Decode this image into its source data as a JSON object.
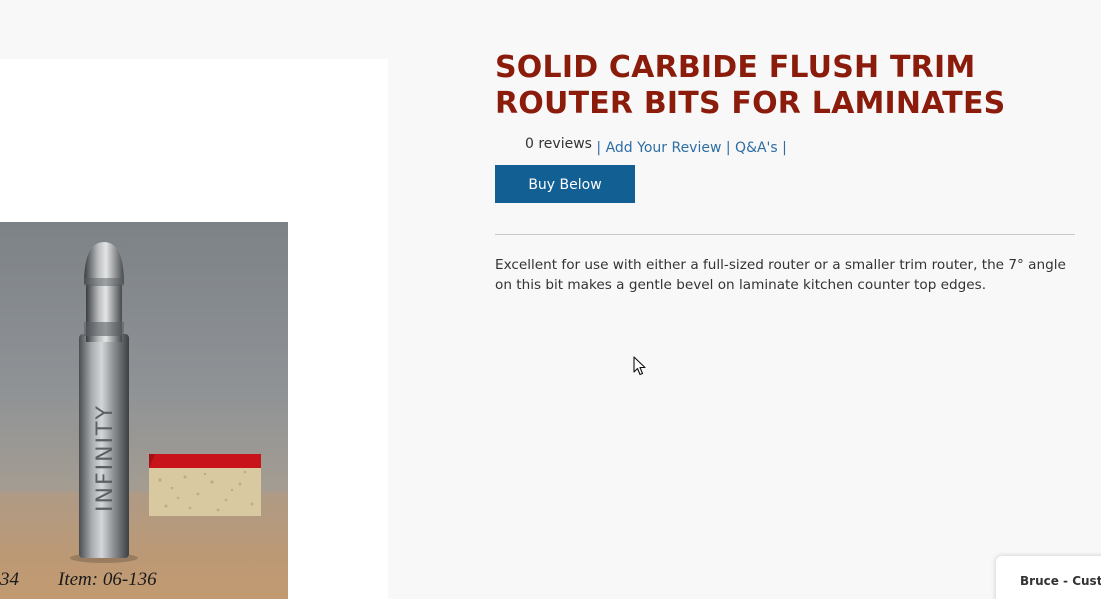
{
  "product": {
    "title": "SOLID CARBIDE FLUSH TRIM ROUTER BITS FOR LAMINATES",
    "reviews_count": "0 reviews",
    "add_review": "Add Your Review",
    "qa": "Q&A's",
    "separator": "|",
    "buy_button": "Buy Below",
    "description": "Excellent for use with either a full-sized router or a smaller trim router, the 7° angle on this bit makes a gentle bevel on laminate kitchen counter top edges."
  },
  "image": {
    "caption_ref": "34",
    "caption_item": "Item: 06-136",
    "brand_engraving": "INFINITY"
  },
  "chat": {
    "label": "Bruce - Custo"
  },
  "colors": {
    "title": "#8b1c0c",
    "link": "#2e6ea3",
    "button": "#125f94",
    "background": "#f8f8f8"
  }
}
